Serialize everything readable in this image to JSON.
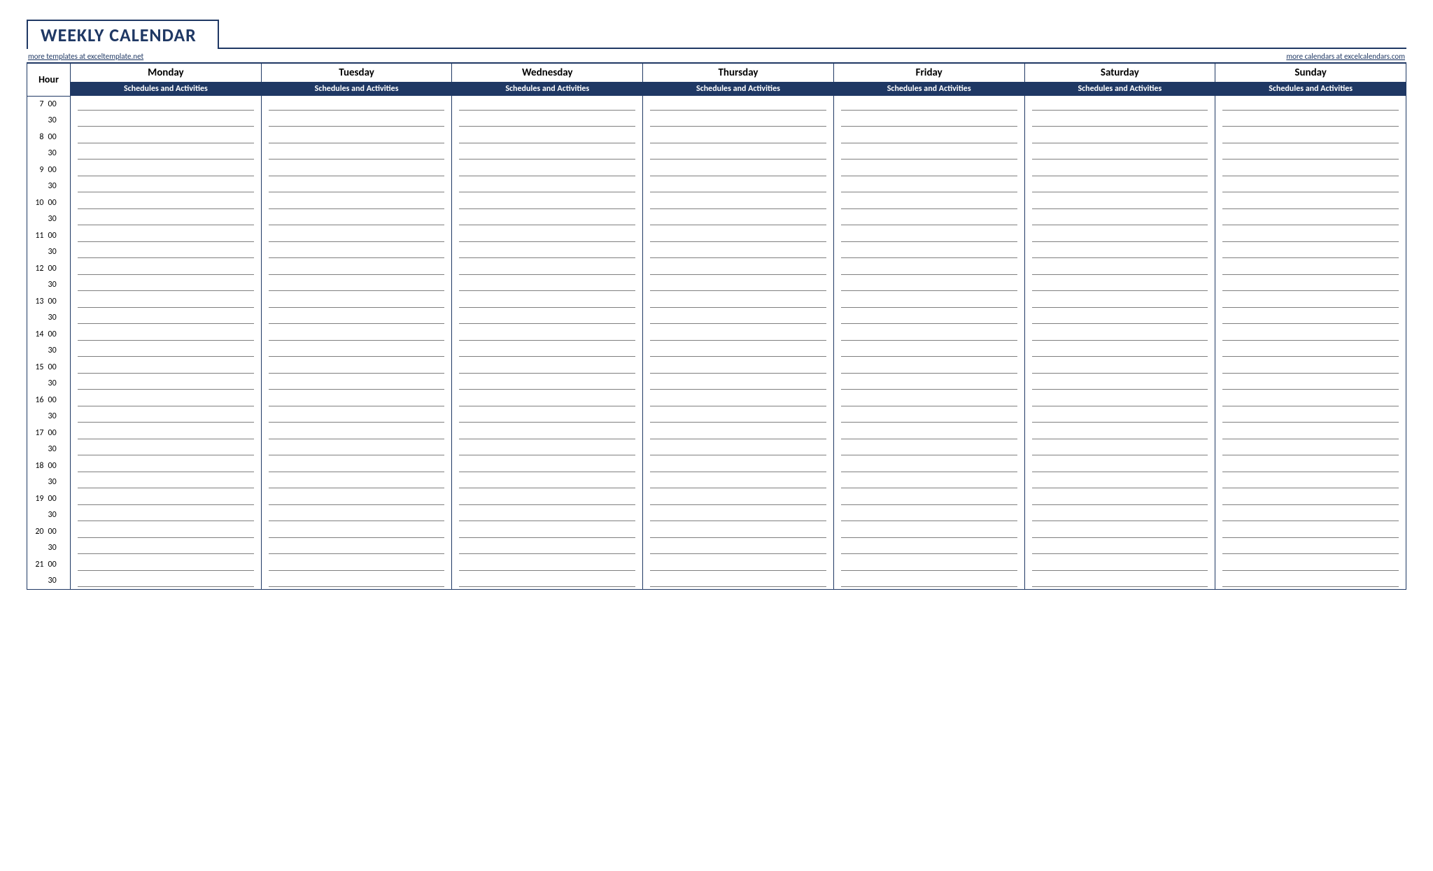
{
  "title": "WEEKLY CALENDAR",
  "links": {
    "left": "more templates at exceltemplate.net",
    "right": "more calendars at excelcalendars.com"
  },
  "hour_label": "Hour",
  "subheader": "Schedules and Activities",
  "days": [
    "Monday",
    "Tuesday",
    "Wednesday",
    "Thursday",
    "Friday",
    "Saturday",
    "Sunday"
  ],
  "time_rows": [
    {
      "h": "7",
      "m": "00"
    },
    {
      "h": "",
      "m": "30"
    },
    {
      "h": "8",
      "m": "00"
    },
    {
      "h": "",
      "m": "30"
    },
    {
      "h": "9",
      "m": "00"
    },
    {
      "h": "",
      "m": "30"
    },
    {
      "h": "10",
      "m": "00"
    },
    {
      "h": "",
      "m": "30"
    },
    {
      "h": "11",
      "m": "00"
    },
    {
      "h": "",
      "m": "30"
    },
    {
      "h": "12",
      "m": "00"
    },
    {
      "h": "",
      "m": "30"
    },
    {
      "h": "13",
      "m": "00"
    },
    {
      "h": "",
      "m": "30"
    },
    {
      "h": "14",
      "m": "00"
    },
    {
      "h": "",
      "m": "30"
    },
    {
      "h": "15",
      "m": "00"
    },
    {
      "h": "",
      "m": "30"
    },
    {
      "h": "16",
      "m": "00"
    },
    {
      "h": "",
      "m": "30"
    },
    {
      "h": "17",
      "m": "00"
    },
    {
      "h": "",
      "m": "30"
    },
    {
      "h": "18",
      "m": "00"
    },
    {
      "h": "",
      "m": "30"
    },
    {
      "h": "19",
      "m": "00"
    },
    {
      "h": "",
      "m": "30"
    },
    {
      "h": "20",
      "m": "00"
    },
    {
      "h": "",
      "m": "30"
    },
    {
      "h": "21",
      "m": "00"
    },
    {
      "h": "",
      "m": "30"
    }
  ]
}
